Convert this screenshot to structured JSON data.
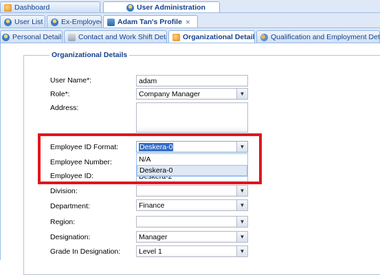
{
  "tabs_top": [
    {
      "label": "Dashboard",
      "icon": "dashboard-icon"
    },
    {
      "label": "User Administration",
      "icon": "user-administration-icon",
      "active": true
    }
  ],
  "tabs_second": [
    {
      "label": "User List",
      "icon": "user-icon"
    },
    {
      "label": "Ex-Employees",
      "icon": "user-icon"
    },
    {
      "label": "Adam Tan's Profile",
      "icon": "profile-card-icon",
      "active": true
    }
  ],
  "tabs_third": [
    {
      "label": "Personal Details",
      "icon": "person-icon"
    },
    {
      "label": "Contact and Work Shift Details",
      "icon": "contact-icon"
    },
    {
      "label": "Organizational Details",
      "icon": "organization-icon",
      "active": true
    },
    {
      "label": "Qualification and Employment Details",
      "icon": "qualification-icon"
    }
  ],
  "form": {
    "legend": "Organizational Details",
    "user_name_label": "User Name*:",
    "user_name_value": "adam",
    "role_label": "Role*:",
    "role_value": "Company Manager",
    "address_label": "Address:",
    "address_value": "",
    "employee_id_format_label": "Employee ID Format:",
    "employee_id_format_value": "Deskera-0",
    "employee_number_label": "Employee Number:",
    "employee_id_label": "Employee ID:",
    "employee_id_value": "Deskera-2",
    "division_label": "Division:",
    "division_value": "",
    "department_label": "Department:",
    "department_value": "Finance",
    "region_label": "Region:",
    "region_value": "",
    "designation_label": "Designation:",
    "designation_value": "Manager",
    "grade_label": "Grade In Designation:",
    "grade_value": "Level 1"
  },
  "dropdown_options": [
    "N/A",
    "Deskera-0"
  ],
  "colors": {
    "highlight_box": "#e0161d",
    "accent": "#15428b"
  }
}
